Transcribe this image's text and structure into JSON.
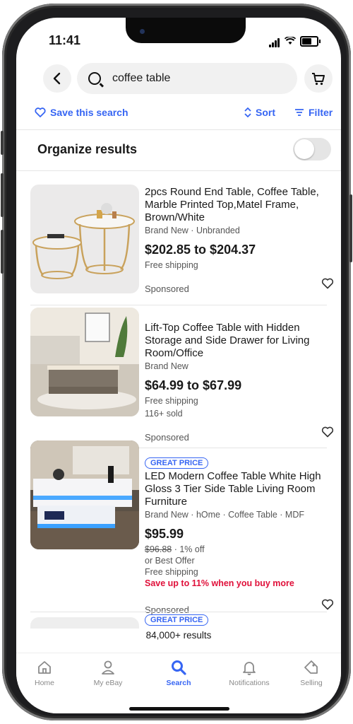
{
  "status": {
    "time": "11:41"
  },
  "search": {
    "query": "coffee table"
  },
  "actions": {
    "save_search": "Save this search",
    "sort": "Sort",
    "filter": "Filter"
  },
  "organize": {
    "label": "Organize results",
    "toggle_on": false
  },
  "listings": [
    {
      "title": "2pcs Round End Table, Coffee Table, Marble Printed Top,Matel Frame, Brown/White",
      "subtitle": "Brand New · Unbranded",
      "price": "$202.85 to $204.37",
      "shipping": "Free shipping",
      "sponsored": "Sponsored"
    },
    {
      "title": "Lift-Top Coffee Table with Hidden Storage and Side Drawer for Living Room/Office",
      "subtitle": "Brand New",
      "price": "$64.99 to $67.99",
      "shipping": "Free shipping",
      "sold": "116+ sold",
      "sponsored": "Sponsored"
    },
    {
      "badge": "GREAT PRICE",
      "title": "LED Modern Coffee Table White High Gloss 3 Tier Side Table Living Room Furniture",
      "subtitle": "Brand New · hOme · Coffee Table · MDF",
      "price": "$95.99",
      "was_price": "$96.88",
      "discount": " · 1% off",
      "offer": "or Best Offer",
      "shipping": "Free shipping",
      "promo": "Save up to 11% when you buy more",
      "sponsored": "Sponsored"
    },
    {
      "badge": "GREAT PRICE"
    }
  ],
  "results_count": "84,000+ results",
  "tabs": [
    {
      "label": "Home",
      "icon": "home-icon"
    },
    {
      "label": "My eBay",
      "icon": "person-icon"
    },
    {
      "label": "Search",
      "icon": "search-icon",
      "active": true
    },
    {
      "label": "Notifications",
      "icon": "bell-icon"
    },
    {
      "label": "Selling",
      "icon": "tag-icon"
    }
  ],
  "colors": {
    "accent": "#3665f3",
    "promo": "#e0103a",
    "text": "#191919",
    "muted": "#555555"
  }
}
